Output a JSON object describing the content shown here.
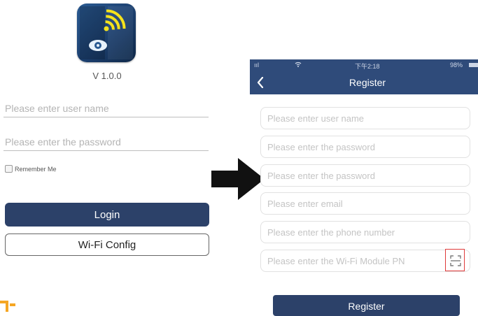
{
  "login": {
    "version": "V 1.0.0",
    "username_placeholder": "Please enter user name",
    "password_placeholder": "Please enter the password",
    "remember_label": "Remember Me",
    "remember_checked": false,
    "login_label": "Login",
    "wifi_config_label": "Wi-Fi Config",
    "icon": "wifi-eye-app-icon"
  },
  "arrow": {
    "icon": "right-arrow-icon",
    "color": "#111111"
  },
  "register": {
    "status_bar": {
      "signal": "ııl",
      "time": "下午2:18",
      "battery": "98%"
    },
    "title": "Register",
    "back_icon": "chevron-left-icon",
    "fields": {
      "username": "Please enter user name",
      "password": "Please enter the password",
      "confirm_password": "Please enter the password",
      "email": "Please enter email",
      "phone": "Please enter the phone number",
      "module_pn": "Please enter the Wi-Fi Module PN"
    },
    "scan_icon": "scan-icon",
    "register_label": "Register"
  },
  "colors": {
    "nav_bar": "#2f4b7a",
    "button": "#2c4169",
    "highlight": "#e03a3a",
    "accent_orange": "#f5a623"
  }
}
